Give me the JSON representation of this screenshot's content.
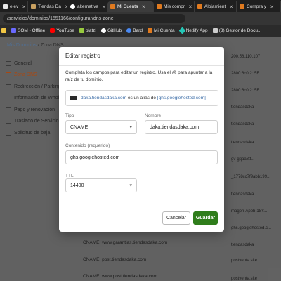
{
  "browser": {
    "tabs": [
      {
        "label": "e ev",
        "color": "#e8e8e8",
        "active": false
      },
      {
        "label": "Tiendas Da",
        "color": "#c8a060",
        "active": false
      },
      {
        "label": "alternativa",
        "color": "#ffffff",
        "active": false
      },
      {
        "label": "Mi Cuenta",
        "color": "#e07a1f",
        "active": true
      },
      {
        "label": "Mis compr",
        "color": "#e07a1f",
        "active": false
      },
      {
        "label": "Alojamient",
        "color": "#e07a1f",
        "active": false
      },
      {
        "label": "Compra y",
        "color": "#e07a1f",
        "active": false
      }
    ],
    "url": "/servicios/dominios/1551166/configurar/dns-zone",
    "bookmarks": [
      {
        "label": "",
        "icon": "folder-icon",
        "color": "#f2c744"
      },
      {
        "label": "SOM - Offline",
        "icon": "som-icon",
        "color": "#6a6aff"
      },
      {
        "label": "YouTube",
        "icon": "youtube-icon",
        "color": "#ff0000"
      },
      {
        "label": "platzi",
        "icon": "platzi-icon",
        "color": "#98ca3f"
      },
      {
        "label": "GitHub",
        "icon": "github-icon",
        "color": "#ffffff"
      },
      {
        "label": "Bard",
        "icon": "bard-icon",
        "color": "#4a8af4"
      },
      {
        "label": "Mi Cuenta",
        "icon": "dh-icon",
        "color": "#e07a1f"
      },
      {
        "label": "Netlify App",
        "icon": "netlify-icon",
        "color": "#25c7b7"
      },
      {
        "label": "(3) Gestor de Docu...",
        "icon": "doc-icon",
        "color": "#cccccc"
      }
    ]
  },
  "breadcrumb": {
    "root": "Mis Dominios",
    "sep": "/",
    "current": "Zona DNS"
  },
  "sidebar": [
    {
      "label": "General",
      "active": false
    },
    {
      "label": "Zona DNS",
      "active": true
    },
    {
      "label": "Redirección / Parking",
      "active": false
    },
    {
      "label": "Información de Whois",
      "active": false
    },
    {
      "label": "Pago y renovación",
      "active": false
    },
    {
      "label": "Traslado de Servicio",
      "active": false
    },
    {
      "label": "Solicitud de baja",
      "active": false
    }
  ],
  "background_values": [
    "200.58.110.107",
    "2800:6c0:2::5F",
    "2800:6c0:2::5F",
    "tiendasdaka",
    "tiendasdaka",
    "tiendasdaka",
    "gv-gqaa8tt...",
    "_1778cc7f9abb199...",
    "tiendasdaka",
    "magon-Appb-18Y...",
    "ghs.googlehosted.c...",
    "tiendasdaka",
    "tiendasdaka",
    "postventa.site",
    "postventa.site"
  ],
  "background_rows": [
    {
      "type": "CNAME",
      "name": "www.garantias.tiendasdaka.com"
    },
    {
      "type": "CNAME",
      "name": "post.tiendasdaka.com"
    },
    {
      "type": "CNAME",
      "name": "www.post.tiendasdaka.com"
    }
  ],
  "modal": {
    "title": "Editar registro",
    "description": "Completa los campos para editar un registro. Usa el @ para apuntar a la raíz de tu dominio.",
    "info": {
      "host": "daka.tiendasdaka.com",
      "middle": " es un alias de ",
      "target": "[ghs.googlehosted.com]"
    },
    "tipo_label": "Tipo",
    "tipo_value": "CNAME",
    "nombre_label": "Nombre",
    "nombre_value": "daka.tiendasdaka.com",
    "contenido_label": "Contenido (requerido)",
    "contenido_value": "ghs.googlehosted.com",
    "ttl_label": "TTL",
    "ttl_value": "14400",
    "cancel_label": "Cancelar",
    "save_label": "Guardar"
  }
}
